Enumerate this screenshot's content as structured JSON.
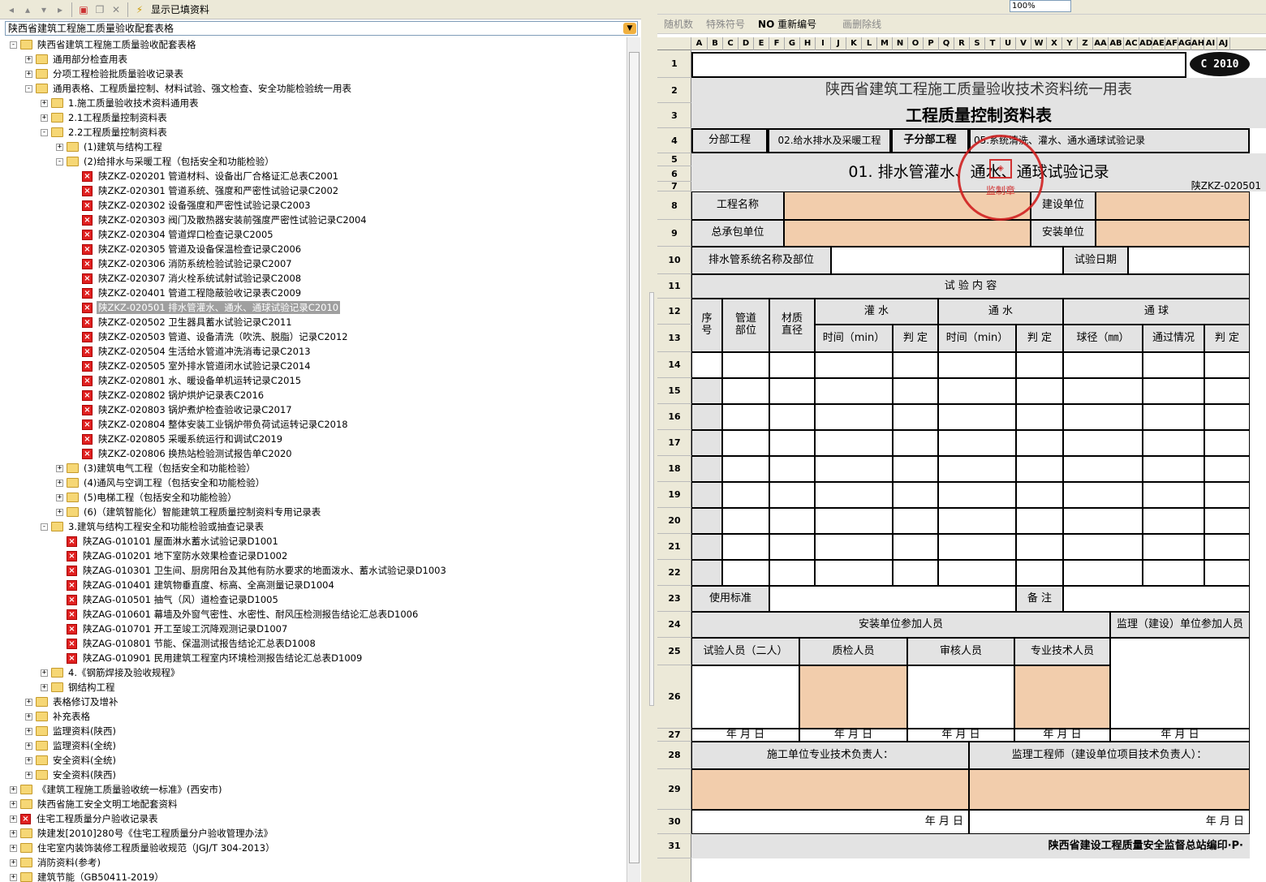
{
  "left_toolbar": {
    "show_filled": "显示已填资料"
  },
  "combo": {
    "value": "陕西省建筑工程施工质量验收配套表格"
  },
  "tree": [
    {
      "lvl": 0,
      "type": "folder",
      "exp": "-",
      "text": "陕西省建筑工程施工质量验收配套表格"
    },
    {
      "lvl": 1,
      "type": "folder",
      "exp": "+",
      "text": "通用部分检查用表"
    },
    {
      "lvl": 1,
      "type": "folder",
      "exp": "+",
      "text": "分项工程检验批质量验收记录表"
    },
    {
      "lvl": 1,
      "type": "folder",
      "exp": "-",
      "text": "通用表格、工程质量控制、材料试验、强文检查、安全功能检验统一用表"
    },
    {
      "lvl": 2,
      "type": "folder",
      "exp": "+",
      "text": "1.施工质量验收技术资料通用表"
    },
    {
      "lvl": 2,
      "type": "folder",
      "exp": "+",
      "text": "2.1工程质量控制资料表"
    },
    {
      "lvl": 2,
      "type": "folder",
      "exp": "-",
      "text": "2.2工程质量控制资料表"
    },
    {
      "lvl": 3,
      "type": "folder",
      "exp": "+",
      "text": "(1)建筑与结构工程"
    },
    {
      "lvl": 3,
      "type": "folder",
      "exp": "-",
      "text": "(2)给排水与采暖工程（包括安全和功能检验）"
    },
    {
      "lvl": 4,
      "type": "doc",
      "text": "陕ZKZ-020201 管道材料、设备出厂合格证汇总表C2001"
    },
    {
      "lvl": 4,
      "type": "doc",
      "text": "陕ZKZ-020301 管道系统、强度和严密性试验记录C2002"
    },
    {
      "lvl": 4,
      "type": "doc",
      "text": "陕ZKZ-020302 设备强度和严密性试验记录C2003"
    },
    {
      "lvl": 4,
      "type": "doc",
      "text": "陕ZKZ-020303 阀门及散热器安装前强度严密性试验记录C2004"
    },
    {
      "lvl": 4,
      "type": "doc",
      "text": "陕ZKZ-020304 管道焊口检查记录C2005"
    },
    {
      "lvl": 4,
      "type": "doc",
      "text": "陕ZKZ-020305 管道及设备保温检查记录C2006"
    },
    {
      "lvl": 4,
      "type": "doc",
      "text": "陕ZKZ-020306 消防系统检验试验记录C2007"
    },
    {
      "lvl": 4,
      "type": "doc",
      "text": "陕ZKZ-020307 消火栓系统试射试验记录C2008"
    },
    {
      "lvl": 4,
      "type": "doc",
      "text": "陕ZKZ-020401 管道工程隐蔽验收记录表C2009"
    },
    {
      "lvl": 4,
      "type": "doc",
      "sel": true,
      "text": "陕ZKZ-020501 排水管灌水、通水、通球试验记录C2010"
    },
    {
      "lvl": 4,
      "type": "doc",
      "text": "陕ZKZ-020502 卫生器具蓄水试验记录C2011"
    },
    {
      "lvl": 4,
      "type": "doc",
      "text": "陕ZKZ-020503 管道、设备清洗（吹洗、脱脂）记录C2012"
    },
    {
      "lvl": 4,
      "type": "doc",
      "text": "陕ZKZ-020504 生活给水管道冲洗消毒记录C2013"
    },
    {
      "lvl": 4,
      "type": "doc",
      "text": "陕ZKZ-020505 室外排水管道闭水试验记录C2014"
    },
    {
      "lvl": 4,
      "type": "doc",
      "text": "陕ZKZ-020801 水、暖设备单机运转记录C2015"
    },
    {
      "lvl": 4,
      "type": "doc",
      "text": "陕ZKZ-020802 锅炉烘炉记录表C2016"
    },
    {
      "lvl": 4,
      "type": "doc",
      "text": "陕ZKZ-020803 锅炉煮炉检查验收记录C2017"
    },
    {
      "lvl": 4,
      "type": "doc",
      "text": "陕ZKZ-020804 整体安装工业锅炉带负荷试运转记录C2018"
    },
    {
      "lvl": 4,
      "type": "doc",
      "text": "陕ZKZ-020805 采暖系统运行和调试C2019"
    },
    {
      "lvl": 4,
      "type": "doc",
      "text": "陕ZKZ-020806 换热站检验测试报告单C2020"
    },
    {
      "lvl": 3,
      "type": "folder",
      "exp": "+",
      "text": "(3)建筑电气工程（包括安全和功能检验）"
    },
    {
      "lvl": 3,
      "type": "folder",
      "exp": "+",
      "text": "(4)通风与空调工程（包括安全和功能检验）"
    },
    {
      "lvl": 3,
      "type": "folder",
      "exp": "+",
      "text": "(5)电梯工程（包括安全和功能检验）"
    },
    {
      "lvl": 3,
      "type": "folder",
      "exp": "+",
      "text": "(6)（建筑智能化）智能建筑工程质量控制资料专用记录表"
    },
    {
      "lvl": 2,
      "type": "folder",
      "exp": "-",
      "text": "3.建筑与结构工程安全和功能检验或抽查记录表"
    },
    {
      "lvl": 3,
      "type": "doc",
      "text": "陕ZAG-010101 屋面淋水蓄水试验记录D1001"
    },
    {
      "lvl": 3,
      "type": "doc",
      "text": "陕ZAG-010201 地下室防水效果检查记录D1002"
    },
    {
      "lvl": 3,
      "type": "doc",
      "text": "陕ZAG-010301 卫生间、厨房阳台及其他有防水要求的地面泼水、蓄水试验记录D1003"
    },
    {
      "lvl": 3,
      "type": "doc",
      "text": "陕ZAG-010401 建筑物垂直度、标高、全高测量记录D1004"
    },
    {
      "lvl": 3,
      "type": "doc",
      "text": "陕ZAG-010501 抽气（风）道检查记录D1005"
    },
    {
      "lvl": 3,
      "type": "doc",
      "text": "陕ZAG-010601 幕墙及外窗气密性、水密性、耐风压检测报告结论汇总表D1006"
    },
    {
      "lvl": 3,
      "type": "doc",
      "text": "陕ZAG-010701 开工至竣工沉降观测记录D1007"
    },
    {
      "lvl": 3,
      "type": "doc",
      "text": "陕ZAG-010801 节能、保温测试报告结论汇总表D1008"
    },
    {
      "lvl": 3,
      "type": "doc",
      "text": "陕ZAG-010901 民用建筑工程室内环境检测报告结论汇总表D1009"
    },
    {
      "lvl": 2,
      "type": "folder",
      "exp": "+",
      "text": "4.《钢筋焊接及验收规程》"
    },
    {
      "lvl": 2,
      "type": "folder",
      "exp": "+",
      "text": "钢结构工程"
    },
    {
      "lvl": 1,
      "type": "folder",
      "exp": "+",
      "text": "表格修订及增补"
    },
    {
      "lvl": 1,
      "type": "folder",
      "exp": "+",
      "text": "补充表格"
    },
    {
      "lvl": 1,
      "type": "folder",
      "exp": "+",
      "text": "监理资料(陕西)"
    },
    {
      "lvl": 1,
      "type": "folder",
      "exp": "+",
      "text": "监理资料(全统)"
    },
    {
      "lvl": 1,
      "type": "folder",
      "exp": "+",
      "text": "安全资料(全统)"
    },
    {
      "lvl": 1,
      "type": "folder",
      "exp": "+",
      "text": "安全资料(陕西)"
    },
    {
      "lvl": 0,
      "type": "folder",
      "exp": "+",
      "text": "《建筑工程施工质量验收统一标准》(西安市)"
    },
    {
      "lvl": 0,
      "type": "folder",
      "exp": "+",
      "text": "陕西省施工安全文明工地配套资料"
    },
    {
      "lvl": 0,
      "type": "doc",
      "exp": "+",
      "text": "住宅工程质量分户验收记录表"
    },
    {
      "lvl": 0,
      "type": "folder",
      "exp": "+",
      "text": "陕建发[2010]280号《住宅工程质量分户验收管理办法》"
    },
    {
      "lvl": 0,
      "type": "folder",
      "exp": "+",
      "text": "住宅室内装饰装修工程质量验收规范（JGJ/T 304-2013）"
    },
    {
      "lvl": 0,
      "type": "folder",
      "exp": "+",
      "text": "消防资料(参考)"
    },
    {
      "lvl": 0,
      "type": "folder",
      "exp": "+",
      "text": "建筑节能（GB50411-2019）"
    }
  ],
  "right_toolbar": {
    "zoom": "100%",
    "random": "随机数",
    "special": "特殊符号",
    "renumber": "重新编号",
    "delete_line": "画删除线",
    "no_label": "NO"
  },
  "columns": [
    "A",
    "B",
    "C",
    "D",
    "E",
    "F",
    "G",
    "H",
    "I",
    "J",
    "K",
    "L",
    "M",
    "N",
    "O",
    "P",
    "Q",
    "R",
    "S",
    "T",
    "U",
    "V",
    "W",
    "X",
    "Y",
    "Z",
    "AA",
    "AB",
    "AC",
    "AD",
    "AE",
    "AF",
    "AG",
    "AH",
    "AI",
    "AJ"
  ],
  "rows": [
    "1",
    "2",
    "3",
    "4",
    "5",
    "6",
    "7",
    "8",
    "9",
    "10",
    "11",
    "12",
    "13",
    "14",
    "15",
    "16",
    "17",
    "18",
    "19",
    "20",
    "21",
    "22",
    "23",
    "24",
    "25",
    "26",
    "27",
    "28",
    "29",
    "30",
    "31"
  ],
  "form": {
    "badge": "C 2010",
    "title1": "陕西省建筑工程施工质量验收技术资料统一用表",
    "title2": "工程质量控制资料表",
    "fenbu_label": "分部工程",
    "fenbu_val": "02.给水排水及采暖工程",
    "zifenbu_label": "子分部工程",
    "zifenbu_val": "05.系统清洗、灌水、通水通球试验记录",
    "title3": "01. 排水管灌水、通水、通球试验记录",
    "code": "陕ZKZ-020501",
    "stamp": "监制章",
    "proj_name": "工程名称",
    "build_unit": "建设单位",
    "gc_unit": "总承包单位",
    "install_unit": "安装单位",
    "sys_name": "排水管系统名称及部位",
    "test_date": "试验日期",
    "test_content": "试 验 内 容",
    "seq": "序号",
    "pipe_part": "管道部位",
    "mat_dia": "材质直径",
    "guanshui": "灌 水",
    "tongshui": "通 水",
    "tongqiu": "通 球",
    "time_min": "时间（min）",
    "judge": "判 定",
    "ball_dia": "球径（㎜）",
    "pass": "通过情况",
    "std": "使用标准",
    "remark": "备 注",
    "install_staff": "安装单位参加人员",
    "supv_staff": "监理（建设）单位参加人员",
    "tester": "试验人员（二人）",
    "qc": "质检人员",
    "reviewer": "审核人员",
    "tech": "专业技术人员",
    "ymd": "年 月 日",
    "cons_head": "施工单位专业技术负责人：",
    "supv_eng": "监理工程师（建设单位项目技术负责人）：",
    "footer": "陕西省建设工程质量安全监督总站编印·P·"
  }
}
